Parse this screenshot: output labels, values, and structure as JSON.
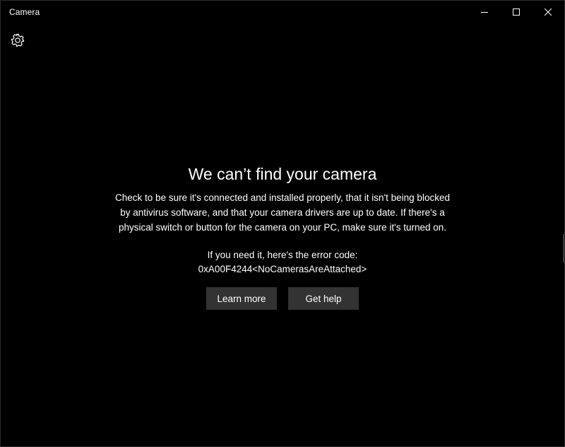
{
  "window": {
    "title": "Camera"
  },
  "caption_buttons": {
    "minimize_icon": "minimize-icon",
    "maximize_icon": "maximize-icon",
    "close_icon": "close-icon"
  },
  "toolbar": {
    "settings_icon": "gear-icon"
  },
  "error": {
    "heading": "We can’t find your camera",
    "message_lines": [
      "Check to be sure it's connected and installed properly, that it isn't being blocked",
      "by antivirus software, and that your camera drivers are up to date. If there's a",
      "physical switch or button for the camera on your PC, make sure it's turned on."
    ],
    "code_label": "If you need it, here's the error code:",
    "code_value": "0xA00F4244<NoCamerasAreAttached>"
  },
  "actions": {
    "learn_more_label": "Learn more",
    "get_help_label": "Get help"
  },
  "colors": {
    "background": "#000000",
    "text": "#ffffff",
    "button_bg": "#333333"
  }
}
